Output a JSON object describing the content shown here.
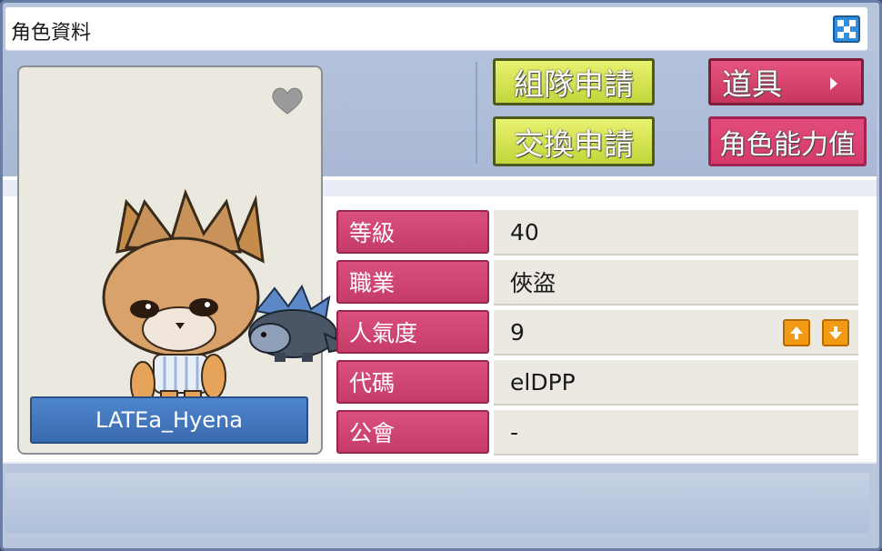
{
  "window": {
    "title": "角色資料",
    "close_icon": "close-icon"
  },
  "buttons": {
    "party_request": "組隊申請",
    "trade_request": "交換申請",
    "items": "道具",
    "character_stats": "角色能力值"
  },
  "character": {
    "name": "LATEa_Hyena"
  },
  "stats": [
    {
      "label": "等級",
      "value": "40"
    },
    {
      "label": "職業",
      "value": "俠盜"
    },
    {
      "label": "人氣度",
      "value": "9"
    },
    {
      "label": "代碼",
      "value": "elDPP"
    },
    {
      "label": "公會",
      "value": "-"
    }
  ],
  "colors": {
    "accent_green": "#c2d63a",
    "accent_pink": "#d63a6a",
    "name_blue": "#3a6ab0",
    "fame_orange": "#f29a16"
  }
}
